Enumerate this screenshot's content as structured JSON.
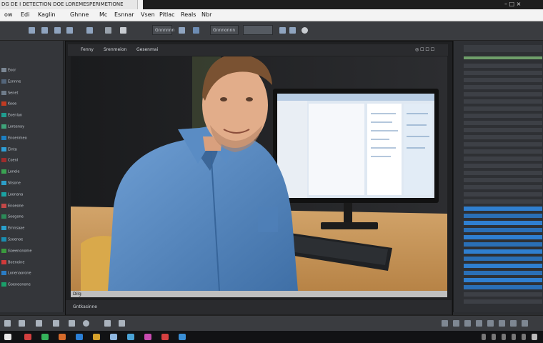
{
  "window": {
    "title": "DG DE I DETECTION DOE LOREMESPERIMETIONE",
    "controls": "– □ ×"
  },
  "menu": [
    {
      "id": "m1",
      "label": "ow"
    },
    {
      "id": "m2",
      "label": "Edi"
    },
    {
      "id": "m3",
      "label": "Kaglin"
    },
    {
      "id": "m4",
      "label": "Ghnne"
    },
    {
      "id": "m5",
      "label": "Mc"
    },
    {
      "id": "m6",
      "label": "Esnnar"
    },
    {
      "id": "m7",
      "label": "Vsen"
    },
    {
      "id": "m8",
      "label": "Pitlac"
    },
    {
      "id": "m9",
      "label": "Reals"
    },
    {
      "id": "m10",
      "label": "Nbr"
    }
  ],
  "toolbar": {
    "field1": "Gnnnnnn",
    "field2": "Gnnnonnn"
  },
  "document_tabs": [
    "Fenny",
    "Srenmeion",
    "Gesenmai"
  ],
  "status_bar": {
    "text": "Dilg"
  },
  "bottom_info": {
    "text": "Gntkasinne"
  },
  "left_panel": {
    "rows": [
      {
        "label": "Eoor",
        "color": "#7b8794"
      },
      {
        "label": "Esnnne",
        "color": "#53657a"
      },
      {
        "label": "Senet",
        "color": "#6f7c8a"
      },
      {
        "label": "Kooe",
        "color": "#c23b22"
      },
      {
        "label": "Eoenlan",
        "color": "#1f9d8f"
      },
      {
        "label": "Loreenay",
        "color": "#3ea37a"
      },
      {
        "label": "Enoenmeo",
        "color": "#1d7fc1"
      },
      {
        "label": "Einta",
        "color": "#2f9fd6"
      },
      {
        "label": "Coenl",
        "color": "#9c2c2c"
      },
      {
        "label": "Lonele",
        "color": "#3aa352"
      },
      {
        "label": "Slisone",
        "color": "#2d9ec8"
      },
      {
        "label": "Loonana",
        "color": "#1aa3a3"
      },
      {
        "label": "Enoeone",
        "color": "#c34848"
      },
      {
        "label": "Soegone",
        "color": "#2b8a58"
      },
      {
        "label": "Ernnsaae",
        "color": "#2aa0cc"
      },
      {
        "label": "Ssoenoe",
        "color": "#1a8eb1"
      },
      {
        "label": "Goeenonome",
        "color": "#3b9a3e"
      },
      {
        "label": "Boenoine",
        "color": "#d03a3a"
      },
      {
        "label": "Lonenaorone",
        "color": "#2b7cc4"
      },
      {
        "label": "Goeneonone",
        "color": "#1aa06a"
      }
    ]
  },
  "colors": {
    "accent_blue": "#2a6fb6",
    "selected_row": "#2f7fd0"
  }
}
